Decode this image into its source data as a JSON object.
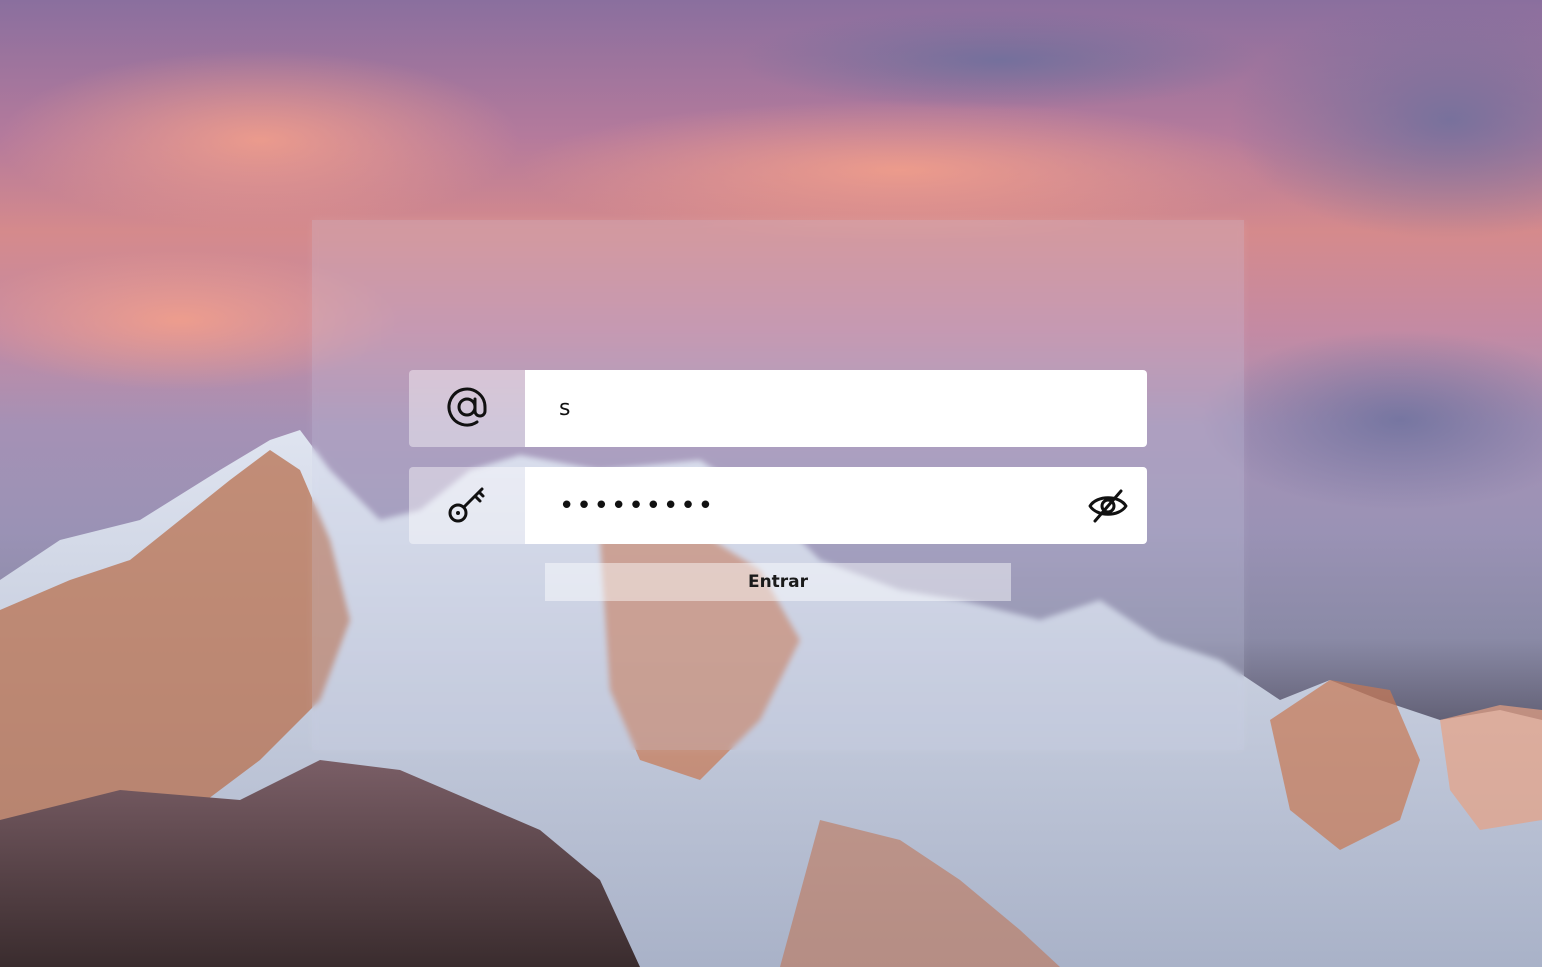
{
  "window": {
    "background": "sierra-mountain-sunset-wallpaper"
  },
  "login": {
    "email": {
      "icon": "at-sign-icon",
      "value": "s"
    },
    "password": {
      "icon": "key-icon",
      "value": "s12345678",
      "toggle_icon": "eye-off-icon"
    },
    "submit_label": "Entrar"
  },
  "colors": {
    "panel": "#cdd2e8",
    "input_bg": "#ffffff",
    "icon_cell": "#ffffff",
    "text": "#111111"
  }
}
